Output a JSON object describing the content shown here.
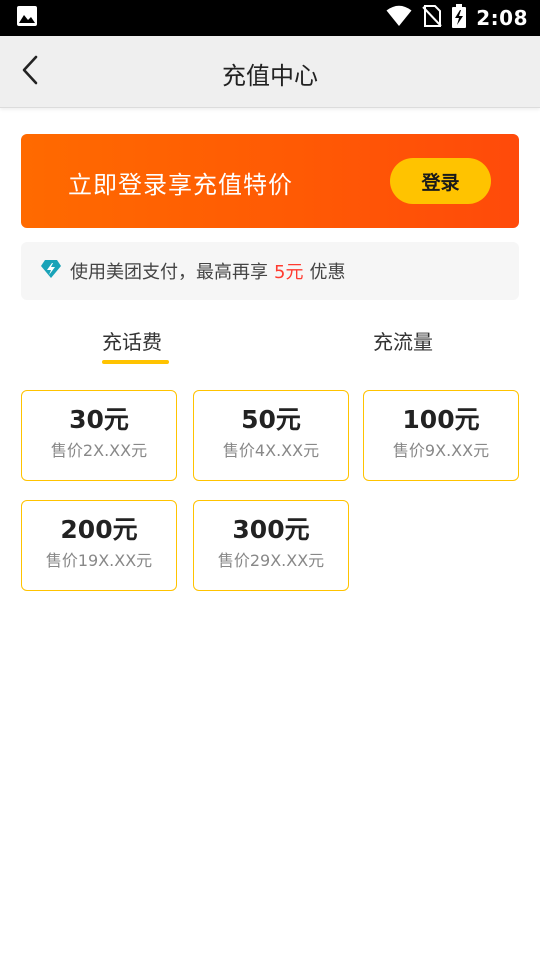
{
  "status_bar": {
    "time": "2:08",
    "icons": [
      "image-icon",
      "wifi-icon",
      "no-sim-icon",
      "battery-charging-icon"
    ]
  },
  "header": {
    "title": "充值中心",
    "back_icon": "chevron-left-icon"
  },
  "promo_banner": {
    "text": "立即登录享充值特价",
    "login_label": "登录",
    "gradient_start": "#ff6a00",
    "gradient_end": "#ff4a0a",
    "button_color": "#ffc300"
  },
  "pay_notice": {
    "icon": "diamond-bolt-icon",
    "text_before": "使用美团支付，最高再享",
    "highlight": "5元",
    "text_after": "优惠",
    "highlight_color": "#ff3b30",
    "icon_color": "#1aa3b8"
  },
  "tabs": {
    "items": [
      {
        "label": "充话费",
        "selected": true
      },
      {
        "label": "充流量",
        "selected": false
      }
    ],
    "underline_color": "#ffc300"
  },
  "amounts": [
    {
      "value": "30元",
      "price": "售价2X.XX元"
    },
    {
      "value": "50元",
      "price": "售价4X.XX元"
    },
    {
      "value": "100元",
      "price": "售价9X.XX元"
    },
    {
      "value": "200元",
      "price": "售价19X.XX元"
    },
    {
      "value": "300元",
      "price": "售价29X.XX元"
    }
  ],
  "card_border_color": "#ffc300"
}
